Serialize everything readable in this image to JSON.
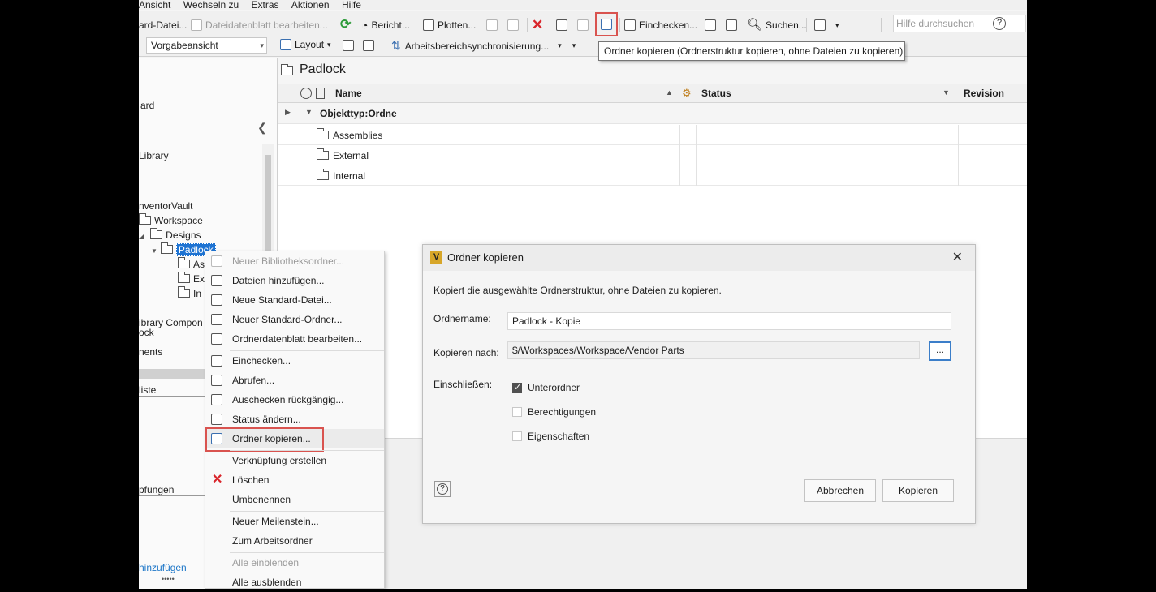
{
  "menubar": [
    "Ansicht",
    "Wechseln zu",
    "Extras",
    "Aktionen",
    "Hilfe"
  ],
  "toolbar1": {
    "std_datei": "ard-Datei...",
    "dateidatenblatt": "Dateidatenblatt bearbeiten...",
    "bericht": "Bericht...",
    "plotten": "Plotten...",
    "einchecken": "Einchecken...",
    "suchen": "Suchen...",
    "help_search_placeholder": "Hilfe durchsuchen",
    "help_icon": "?"
  },
  "toolbar2": {
    "view_select": "Vorgabeansicht",
    "layout": "Layout",
    "sync": "Arbeitsbereichsynchronisierung..."
  },
  "tooltip": "Ordner kopieren (Ordnerstruktur kopieren, ohne Dateien zu kopieren)",
  "left_panel": {
    "items": [
      "ard",
      "Library",
      "nventorVault",
      "Workspace",
      "Designs",
      "Padlock",
      "As",
      "Ex",
      "In",
      "ibrary Compon",
      "ock",
      "nents",
      "liste",
      "pfungen",
      "hinzufügen"
    ]
  },
  "right_panel": {
    "folder_title": "Padlock",
    "columns": {
      "name": "Name",
      "status": "Status",
      "revision": "Revision"
    },
    "group": "Objekttyp:Ordne",
    "rows": [
      "Assemblies",
      "External",
      "Internal"
    ]
  },
  "context_menu": {
    "items": [
      "Neuer Bibliotheksordner...",
      "Dateien hinzufügen...",
      "Neue Standard-Datei...",
      "Neuer Standard-Ordner...",
      "Ordnerdatenblatt bearbeiten...",
      "Einchecken...",
      "Abrufen...",
      "Auschecken rückgängig...",
      "Status ändern...",
      "Ordner kopieren...",
      "Verknüpfung erstellen",
      "Löschen",
      "Umbenennen",
      "Neuer Meilenstein...",
      "Zum Arbeitsordner",
      "Alle einblenden",
      "Alle ausblenden"
    ]
  },
  "dialog": {
    "logo": "V",
    "title": "Ordner kopieren",
    "close": "✕",
    "description": "Kopiert die ausgewählte Ordnerstruktur, ohne Dateien zu kopieren.",
    "ordnername_label": "Ordnername:",
    "ordnername_value": "Padlock - Kopie",
    "kopieren_nach_label": "Kopieren nach:",
    "kopieren_nach_value": "$/Workspaces/Workspace/Vendor Parts",
    "browse": "...",
    "einschliessen_label": "Einschließen:",
    "options": [
      {
        "label": "Unterordner",
        "checked": true
      },
      {
        "label": "Berechtigungen",
        "checked": false
      },
      {
        "label": "Eigenschaften",
        "checked": false
      }
    ],
    "help": "?",
    "cancel": "Abbrechen",
    "ok": "Kopieren"
  }
}
